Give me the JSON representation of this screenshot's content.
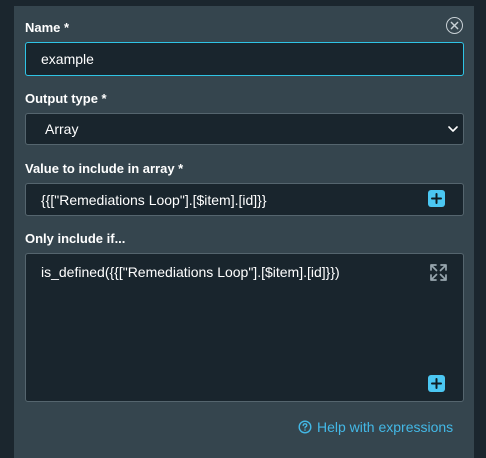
{
  "form": {
    "name": {
      "label": "Name *",
      "value": "example"
    },
    "output_type": {
      "label": "Output type *",
      "selected": "Array"
    },
    "value_field": {
      "label": "Value to include in array *",
      "value": "{{[\"Remediations Loop\"].[$item].[id]}}"
    },
    "condition": {
      "label": "Only include if...",
      "value": "is_defined({{[\"Remediations Loop\"].[$item].[id]}})"
    },
    "help_link": "Help with expressions"
  },
  "icons": {
    "close": "close-circle-icon",
    "dropdown": "chevron-down-icon",
    "add": "plus-icon",
    "expand": "expand-icon",
    "help": "help-circle-icon"
  },
  "colors": {
    "panel": "#35454e",
    "input_bg": "#19252d",
    "focus_border": "#2fc4e5",
    "accent": "#4bc7f2",
    "link": "#43b8e6"
  }
}
